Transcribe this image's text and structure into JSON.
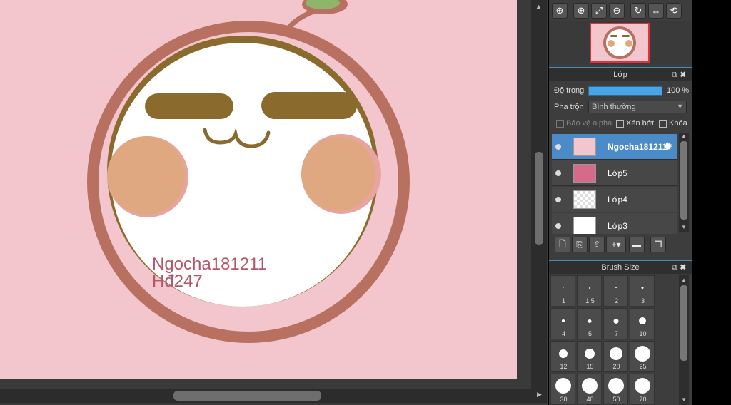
{
  "canvas": {
    "signature_line1": "Ngocha181211",
    "signature_line2": "Hđ247",
    "background_color": "#f3c6cd"
  },
  "navigator": {
    "tools": [
      {
        "name": "zoom-in-icon",
        "glyph": "⊕"
      },
      {
        "name": "zoom-in-2-icon",
        "glyph": "⊕"
      },
      {
        "name": "fit-icon",
        "glyph": "⤢"
      },
      {
        "name": "zoom-out-icon",
        "glyph": "⊖"
      },
      {
        "name": "rotate-icon",
        "glyph": "↻"
      },
      {
        "name": "flip-icon",
        "glyph": "⇔"
      },
      {
        "name": "reset-rotate-icon",
        "glyph": "⟲"
      }
    ]
  },
  "layer_panel": {
    "title": "Lớp",
    "opacity_label": "Độ trong",
    "opacity_value": "100 %",
    "opacity_fraction": 1.0,
    "blend_label": "Pha trộn",
    "blend_value": "Bình thường",
    "protect_alpha_label": "Bảo vệ alpha",
    "clipping_label": "Xén bớt",
    "lock_label": "Khóa",
    "layers": [
      {
        "name": "Ngocha181211",
        "selected": true
      },
      {
        "name": "Lớp5",
        "selected": false
      },
      {
        "name": "Lớp4",
        "selected": false
      },
      {
        "name": "Lớp3",
        "selected": false
      }
    ]
  },
  "brush_panel": {
    "title": "Brush Size",
    "sizes": [
      "1",
      "1.5",
      "2",
      "3",
      "4",
      "5",
      "7",
      "10",
      "12",
      "15",
      "20",
      "25",
      "30",
      "40",
      "50",
      "70"
    ]
  },
  "colors": {
    "accent": "#4b8cc8",
    "face_ring": "#b87060",
    "brow": "#8b6a2e",
    "blush": "#e0a880",
    "signature": "#b5566b"
  }
}
